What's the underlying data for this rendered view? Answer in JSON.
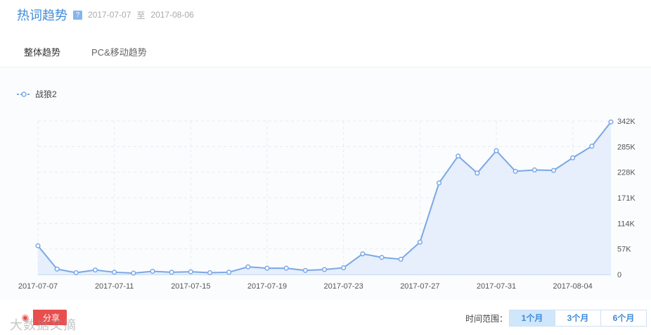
{
  "header": {
    "title": "热词趋势",
    "help_icon": "?",
    "date_from": "2017-07-07",
    "date_sep": "至",
    "date_to": "2017-08-06"
  },
  "tabs": [
    {
      "label": "整体趋势",
      "active": true
    },
    {
      "label": "PC&移动趋势",
      "active": false
    }
  ],
  "colors": {
    "accent": "#3d8bd9",
    "line": "#7ba7e6",
    "area": "#e3edfb"
  },
  "chart_data": {
    "type": "area",
    "series": [
      {
        "name": "战狼2",
        "values": [
          64000,
          12000,
          4000,
          10000,
          5000,
          3000,
          7000,
          5000,
          6000,
          4000,
          5000,
          17000,
          14000,
          14000,
          9000,
          11000,
          15000,
          46000,
          38000,
          34000,
          72000,
          204000,
          264000,
          226000,
          276000,
          230000,
          233000,
          232000,
          260000,
          286000,
          340000
        ]
      }
    ],
    "x": [
      "2017-07-07",
      "2017-07-08",
      "2017-07-09",
      "2017-07-10",
      "2017-07-11",
      "2017-07-12",
      "2017-07-13",
      "2017-07-14",
      "2017-07-15",
      "2017-07-16",
      "2017-07-17",
      "2017-07-18",
      "2017-07-19",
      "2017-07-20",
      "2017-07-21",
      "2017-07-22",
      "2017-07-23",
      "2017-07-24",
      "2017-07-25",
      "2017-07-26",
      "2017-07-27",
      "2017-07-28",
      "2017-07-29",
      "2017-07-30",
      "2017-07-31",
      "2017-08-01",
      "2017-08-02",
      "2017-08-03",
      "2017-08-04",
      "2017-08-05",
      "2017-08-06"
    ],
    "x_tick_labels": [
      "2017-07-07",
      "2017-07-11",
      "2017-07-15",
      "2017-07-19",
      "2017-07-23",
      "2017-07-27",
      "2017-07-31",
      "2017-08-04"
    ],
    "y_ticks": [
      0,
      57000,
      114000,
      171000,
      228000,
      285000,
      342000
    ],
    "y_tick_labels": [
      "0",
      "57K",
      "114K",
      "171K",
      "228K",
      "285K",
      "342K"
    ],
    "ylim": [
      0,
      342000
    ],
    "grid": true,
    "legend": "top-left"
  },
  "footer": {
    "share_label": "分享",
    "weibo_icon": "weibo",
    "watermark": "大数据文摘",
    "range_label": "时间范围：",
    "range_options": [
      {
        "label": "1个月",
        "active": true
      },
      {
        "label": "3个月",
        "active": false
      },
      {
        "label": "6个月",
        "active": false
      }
    ]
  }
}
